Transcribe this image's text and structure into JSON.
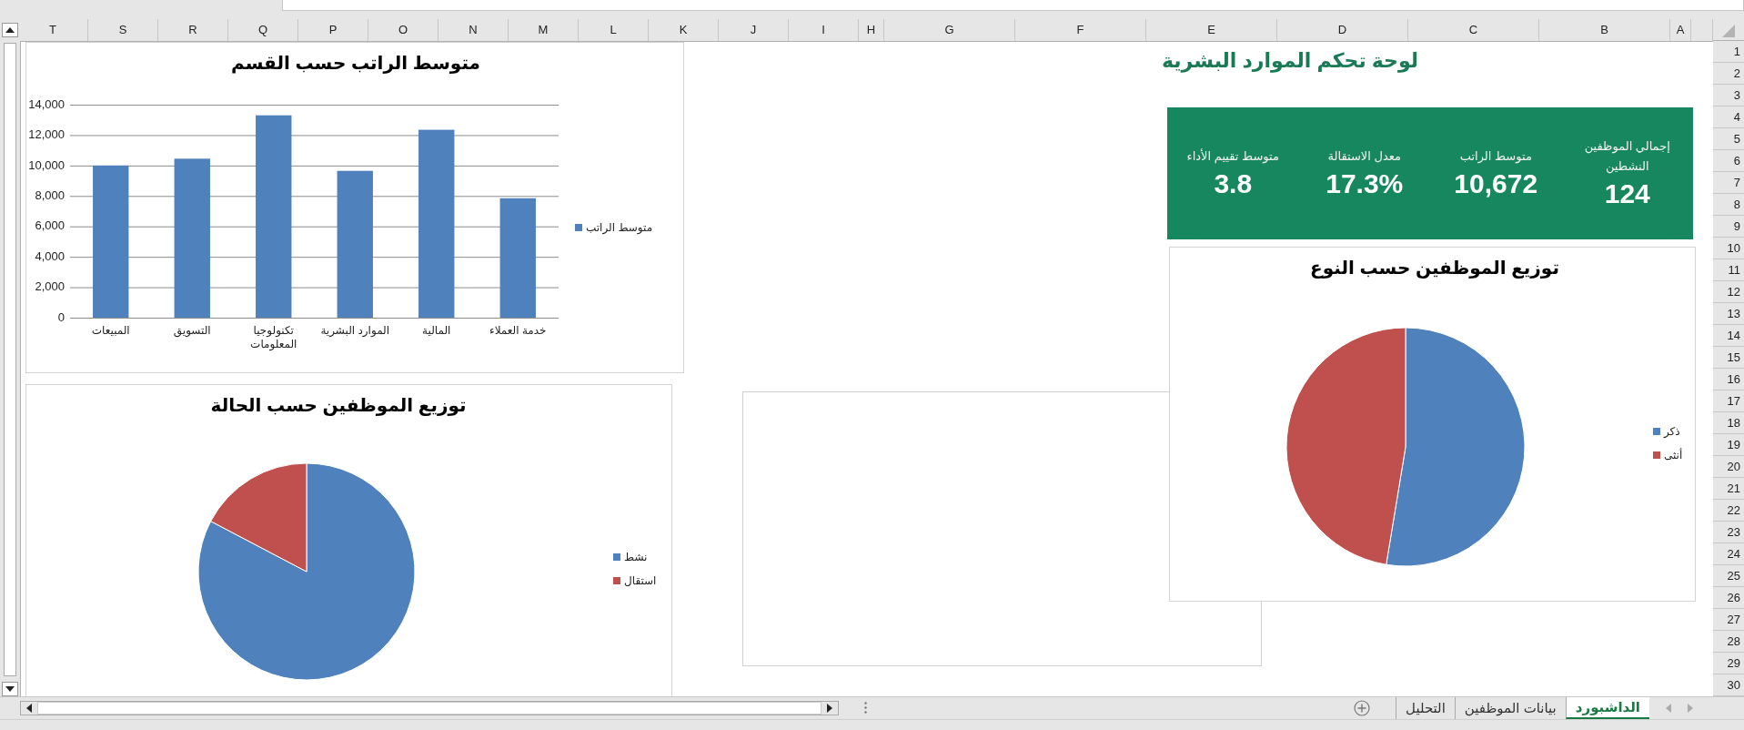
{
  "columns": [
    "A",
    "B",
    "C",
    "D",
    "E",
    "F",
    "G",
    "H",
    "I",
    "J",
    "K",
    "L",
    "M",
    "N",
    "O",
    "P",
    "Q",
    "R",
    "S",
    "T"
  ],
  "rows": [
    "1",
    "2",
    "3",
    "4",
    "5",
    "6",
    "7",
    "8",
    "9",
    "10",
    "11",
    "12",
    "13",
    "14",
    "15",
    "16",
    "17",
    "18",
    "19",
    "20",
    "21",
    "22",
    "23",
    "24",
    "25",
    "26",
    "27",
    "28",
    "29",
    "30"
  ],
  "dashboard_title": "لوحة تحكم الموارد البشرية",
  "kpis": [
    {
      "label": "إجمالي الموظفين النشطين",
      "value": "124"
    },
    {
      "label": "متوسط الراتب",
      "value": "10,672"
    },
    {
      "label": "معدل الاستقالة",
      "value": "17.3%"
    },
    {
      "label": "متوسط تقييم الأداء",
      "value": "3.8"
    }
  ],
  "salary_chart": {
    "chart_data": {
      "type": "bar",
      "title": "متوسط الراتب حسب القسم",
      "categories": [
        "المبيعات",
        "التسويق",
        "تكنولوجيا المعلومات",
        "الموارد البشرية",
        "المالية",
        "خدمة العملاء"
      ],
      "series": [
        {
          "name": "متوسط الراتب",
          "color": "#4f81bd",
          "values": [
            10000,
            10450,
            13300,
            9650,
            12350,
            7850
          ]
        }
      ],
      "grid": true,
      "legend": true,
      "ylim": [
        0,
        14000
      ],
      "yticks": [
        {
          "value": 14000,
          "label": "14,000"
        },
        {
          "value": 12000,
          "label": "12,000"
        },
        {
          "value": 10000,
          "label": "10,000"
        },
        {
          "value": 8000,
          "label": "8,000"
        },
        {
          "value": 6000,
          "label": "6,000"
        },
        {
          "value": 4000,
          "label": "4,000"
        },
        {
          "value": 2000,
          "label": "2,000"
        },
        {
          "value": 0,
          "label": "0"
        }
      ]
    }
  },
  "status_chart": {
    "chart_data": {
      "type": "pie",
      "title": "توزيع الموظفين حسب الحالة",
      "categories": [
        "نشط",
        "استقال"
      ],
      "series": [
        {
          "values": [
            82.7,
            17.3
          ]
        }
      ],
      "colors": [
        "#4f81bd",
        "#c0504d"
      ],
      "legend": true
    }
  },
  "gender_chart": {
    "chart_data": {
      "type": "pie",
      "title": "توزيع الموظفين حسب النوع",
      "categories": [
        "ذكر",
        "أنثى"
      ],
      "series": [
        {
          "values": [
            52.6,
            47.4
          ]
        }
      ],
      "colors": [
        "#4f81bd",
        "#c0504d"
      ],
      "legend": true
    }
  },
  "sheet_tabs": [
    {
      "label": "الداشبورد",
      "selected": true
    },
    {
      "label": "بيانات الموظفين",
      "selected": false
    },
    {
      "label": "التحليل",
      "selected": false
    }
  ]
}
